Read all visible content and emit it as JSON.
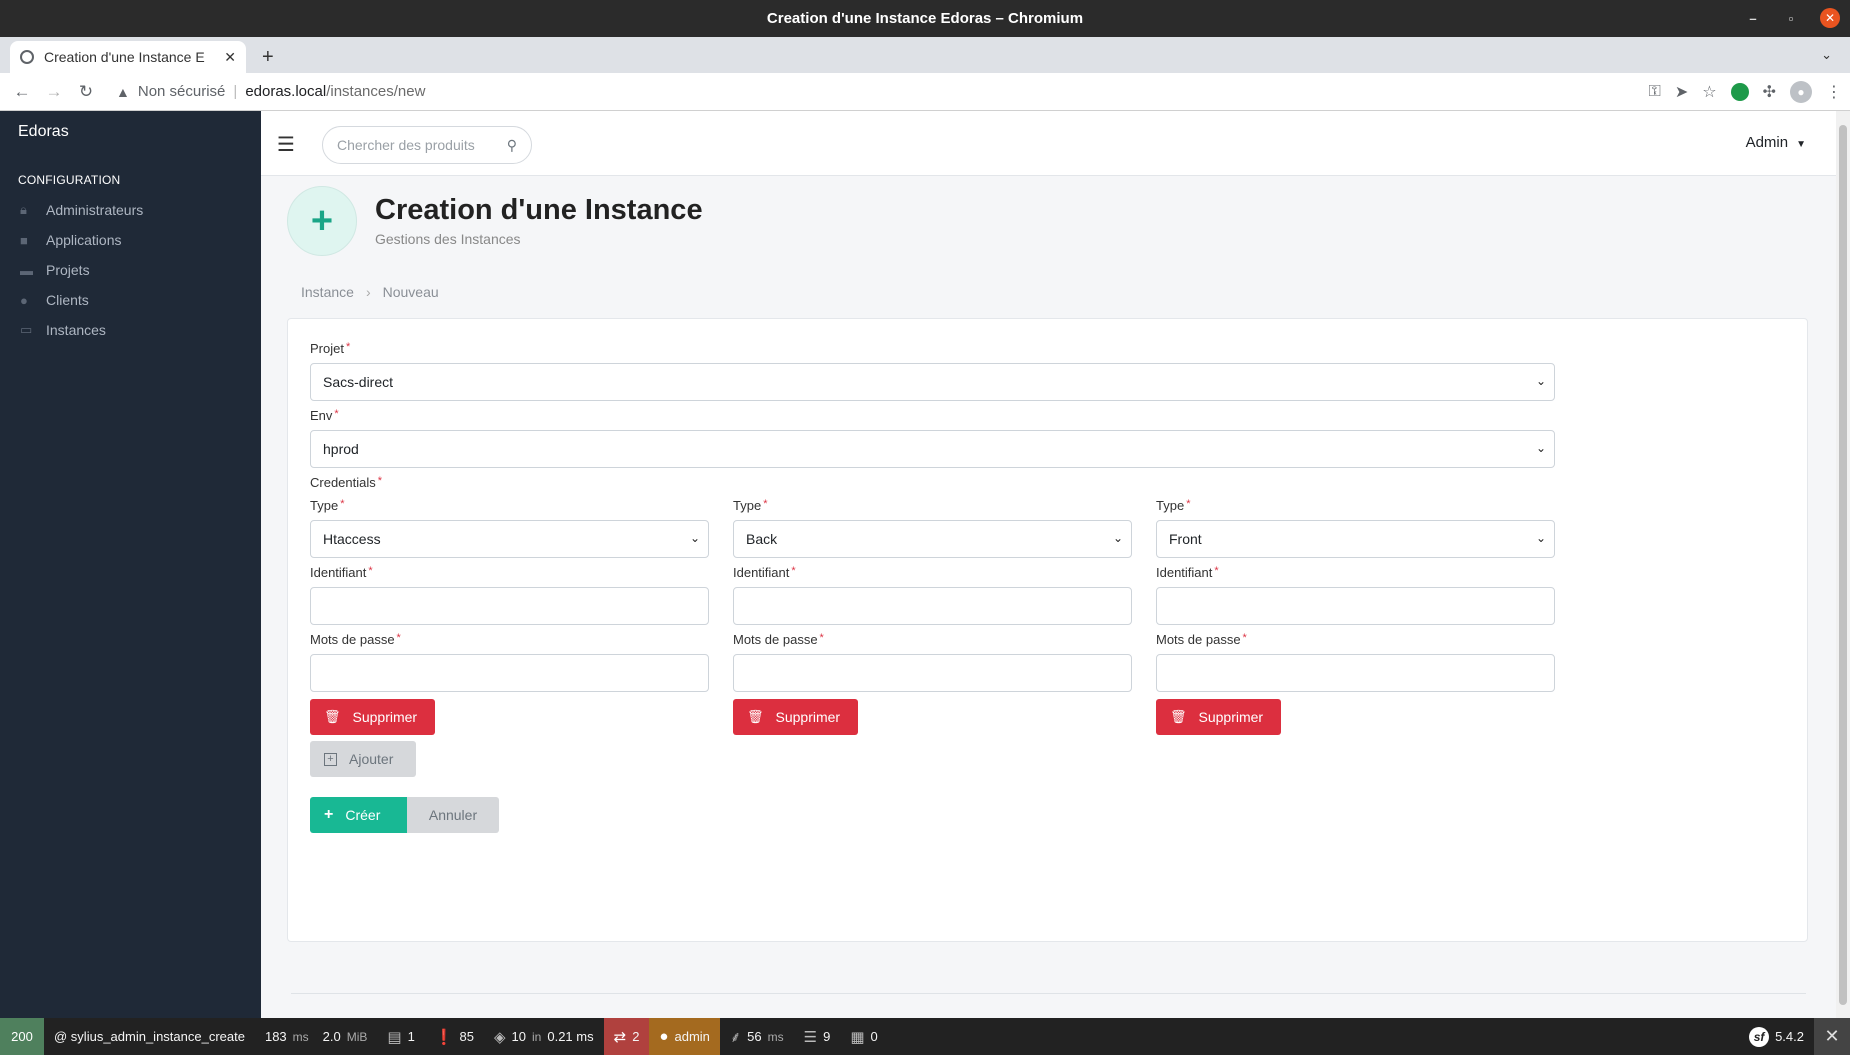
{
  "window": {
    "title": "Creation d'une Instance Edoras – Chromium"
  },
  "browser": {
    "tab_title": "Creation d'une Instance E",
    "security_label": "Non sécurisé",
    "url_host": "edoras.local",
    "url_path": "/instances/new"
  },
  "sidebar": {
    "brand": "Edoras",
    "section": "CONFIGURATION",
    "items": [
      {
        "label": "Administrateurs",
        "icon": "lock-icon"
      },
      {
        "label": "Applications",
        "icon": "briefcase-icon"
      },
      {
        "label": "Projets",
        "icon": "folder-icon"
      },
      {
        "label": "Clients",
        "icon": "user-icon"
      },
      {
        "label": "Instances",
        "icon": "monitor-icon"
      }
    ]
  },
  "topbar": {
    "search_placeholder": "Chercher des produits",
    "user_menu": "Admin"
  },
  "header": {
    "title": "Creation d'une Instance",
    "subtitle": "Gestions des Instances"
  },
  "breadcrumb": [
    "Instance",
    "Nouveau"
  ],
  "form": {
    "projet_label": "Projet",
    "projet_value": "Sacs-direct",
    "env_label": "Env",
    "env_value": "hprod",
    "credentials_label": "Credentials",
    "credentials": [
      {
        "type_label": "Type",
        "type_value": "Htaccess",
        "id_label": "Identifiant",
        "pwd_label": "Mots de passe",
        "delete_label": "Supprimer"
      },
      {
        "type_label": "Type",
        "type_value": "Back",
        "id_label": "Identifiant",
        "pwd_label": "Mots de passe",
        "delete_label": "Supprimer"
      },
      {
        "type_label": "Type",
        "type_value": "Front",
        "id_label": "Identifiant",
        "pwd_label": "Mots de passe",
        "delete_label": "Supprimer"
      }
    ],
    "add_label": "Ajouter",
    "create_label": "Créer",
    "cancel_label": "Annuler",
    "required_mark": "*"
  },
  "debug_toolbar": {
    "status": "200",
    "route": "@ sylius_admin_instance_create",
    "time_value": "183",
    "time_unit": "ms",
    "memory_value": "2.0",
    "memory_unit": "MiB",
    "forms": "1",
    "logs": "85",
    "db_queries": "10",
    "db_in": "in",
    "db_time": "0.21 ms",
    "translations": "2",
    "user": "admin",
    "twig_time": "56",
    "twig_unit": "ms",
    "events": "9",
    "blocks": "0",
    "symfony_version": "5.4.2",
    "colors": {
      "status": "#4f805d",
      "translations": "#b0413e",
      "user": "#a46a1f"
    }
  },
  "colors": {
    "sidebar_bg": "#1f2937",
    "accent": "#18b894",
    "danger": "#dc2f3f"
  }
}
